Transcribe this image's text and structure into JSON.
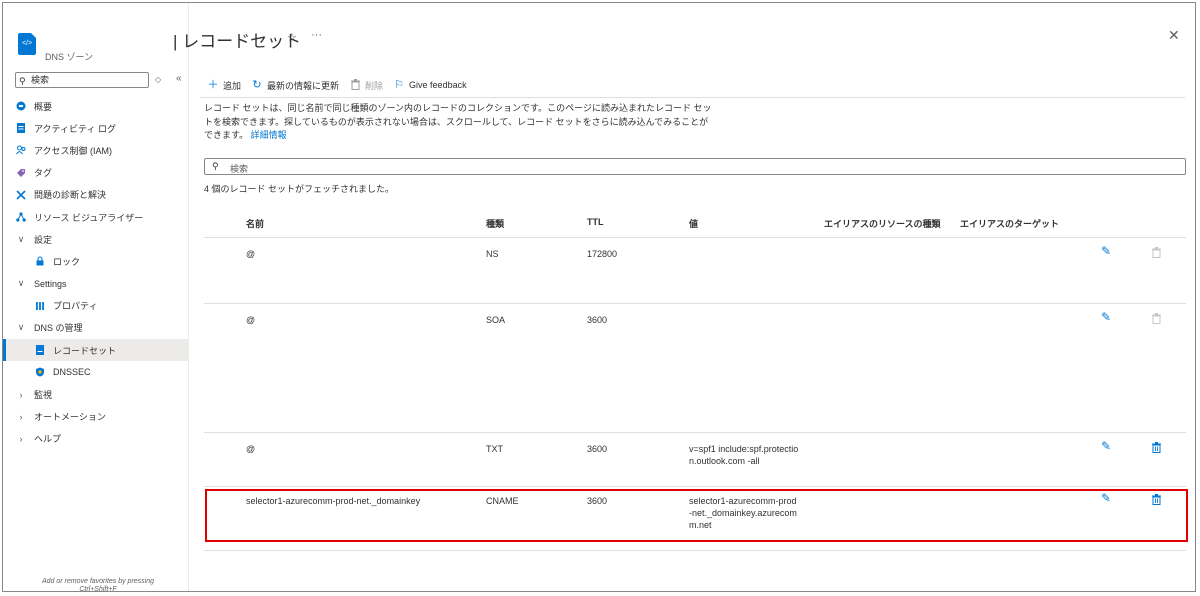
{
  "resource": {
    "icon": "dns-zone-icon",
    "type_label": "DNS ゾーン"
  },
  "page": {
    "title": "| レコードセット"
  },
  "sidebar": {
    "search_placeholder": "検索",
    "search_extra": "◇",
    "collapse_glyph": "«",
    "items": [
      {
        "label": "概要",
        "icon": "overview-icon",
        "indent": false
      },
      {
        "label": "アクティビティ ログ",
        "icon": "activity-log-icon",
        "indent": false
      },
      {
        "label": "アクセス制御 (IAM)",
        "icon": "iam-icon",
        "indent": false
      },
      {
        "label": "タグ",
        "icon": "tag-icon",
        "indent": false
      },
      {
        "label": "問題の診断と解決",
        "icon": "diagnose-icon",
        "indent": false
      },
      {
        "label": "リソース ビジュアライザー",
        "icon": "visualizer-icon",
        "indent": false
      },
      {
        "label": "設定",
        "icon": "chevron-down-icon",
        "indent": false
      },
      {
        "label": "ロック",
        "icon": "lock-icon",
        "indent": true
      },
      {
        "label": "Settings",
        "icon": "chevron-down-icon",
        "indent": false
      },
      {
        "label": "プロパティ",
        "icon": "properties-icon",
        "indent": true
      },
      {
        "label": "DNS の管理",
        "icon": "chevron-down-icon",
        "indent": false
      },
      {
        "label": "レコードセット",
        "icon": "recordset-icon",
        "indent": true,
        "active": true
      },
      {
        "label": "DNSSEC",
        "icon": "dnssec-icon",
        "indent": true
      },
      {
        "label": "監視",
        "icon": "chevron-right-icon",
        "indent": false
      },
      {
        "label": "オートメーション",
        "icon": "chevron-right-icon",
        "indent": false
      },
      {
        "label": "ヘルプ",
        "icon": "chevron-right-icon",
        "indent": false
      }
    ],
    "favorites_hint_line1": "Add or remove favorites by pressing",
    "favorites_hint_line2": "Ctrl+Shift+F"
  },
  "toolbar": {
    "add_label": "追加",
    "refresh_label": "最新の情報に更新",
    "delete_label": "削除",
    "feedback_label": "Give feedback"
  },
  "description": {
    "text": "レコード セットは、同じ名前で同じ種類のゾーン内のレコードのコレクションです。このページに読み込まれたレコード セットを検索できます。探しているものが表示されない場合は、スクロールして、レコード セットをさらに読み込んでみることができます。",
    "link": "詳細情報"
  },
  "search": {
    "placeholder": "検索"
  },
  "status": {
    "fetched": "4 個のレコード セットがフェッチされました。"
  },
  "table": {
    "headers": {
      "name": "名前",
      "type": "種類",
      "ttl": "TTL",
      "value": "値",
      "alias_type": "エイリアスのリソースの種類",
      "alias_target": "エイリアスのターゲット"
    },
    "rows": [
      {
        "name": "@",
        "type": "NS",
        "ttl": "172800",
        "value": "",
        "delete_enabled": false
      },
      {
        "name": "@",
        "type": "SOA",
        "ttl": "3600",
        "value": "",
        "delete_enabled": false
      },
      {
        "name": "@",
        "type": "TXT",
        "ttl": "3600",
        "value": "v=spf1 include:spf.protection.outlook.com -all",
        "delete_enabled": true
      },
      {
        "name": "selector1-azurecomm-prod-net._domainkey",
        "type": "CNAME",
        "ttl": "3600",
        "value": "selector1-azurecomm-prod-net._domainkey.azurecomm.net",
        "delete_enabled": true,
        "highlighted": true
      }
    ]
  },
  "colors": {
    "accent": "#0078d4",
    "highlight": "#e00000"
  }
}
